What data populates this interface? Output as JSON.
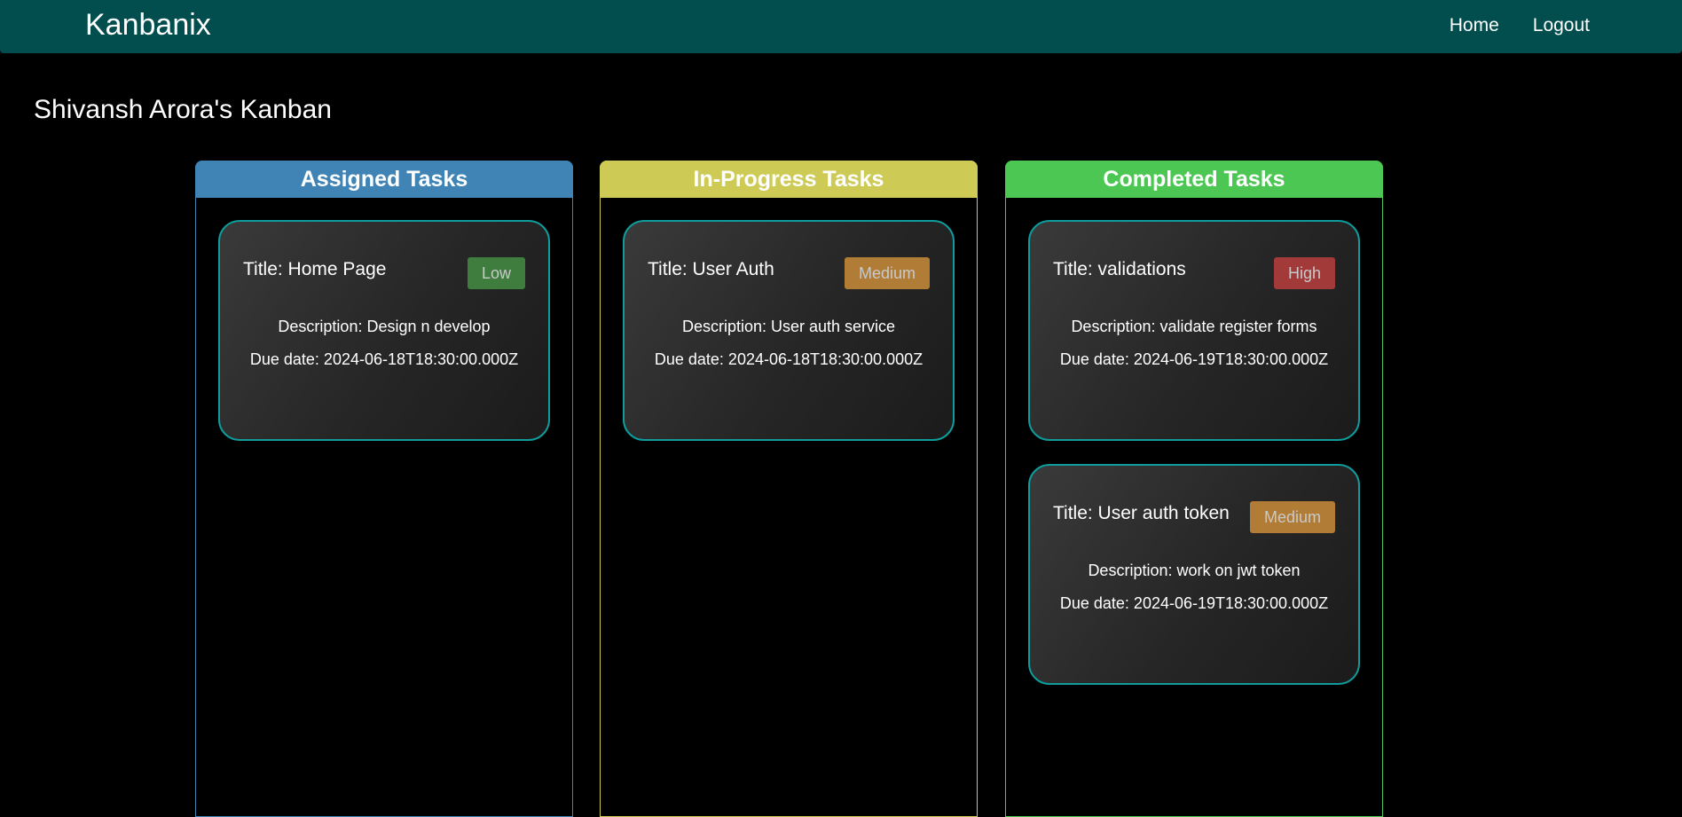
{
  "app": {
    "brand": "Kanbanix",
    "nav": {
      "home_label": "Home",
      "logout_label": "Logout"
    }
  },
  "page": {
    "title": "Shivansh Arora's Kanban"
  },
  "colors": {
    "navbar": "#024d4d",
    "assigned": "#3f84b5",
    "in_progress": "#cdcb55",
    "completed": "#4cc753",
    "card_border": "#0e9c9c",
    "low": "#3f7d3f",
    "medium": "#b07c36",
    "high": "#a33a3a"
  },
  "columns": [
    {
      "header": "Assigned Tasks",
      "cards": [
        {
          "title": "Title: Home Page",
          "priority": "Low",
          "description": "Description: Design n develop",
          "due": "Due date: 2024-06-18T18:30:00.000Z"
        }
      ]
    },
    {
      "header": "In-Progress Tasks",
      "cards": [
        {
          "title": "Title: User Auth",
          "priority": "Medium",
          "description": "Description: User auth service",
          "due": "Due date: 2024-06-18T18:30:00.000Z"
        }
      ]
    },
    {
      "header": "Completed Tasks",
      "cards": [
        {
          "title": "Title: validations",
          "priority": "High",
          "description": "Description: validate register forms",
          "due": "Due date: 2024-06-19T18:30:00.000Z"
        },
        {
          "title": "Title: User auth token",
          "priority": "Medium",
          "description": "Description: work on jwt token",
          "due": "Due date: 2024-06-19T18:30:00.000Z"
        }
      ]
    }
  ]
}
